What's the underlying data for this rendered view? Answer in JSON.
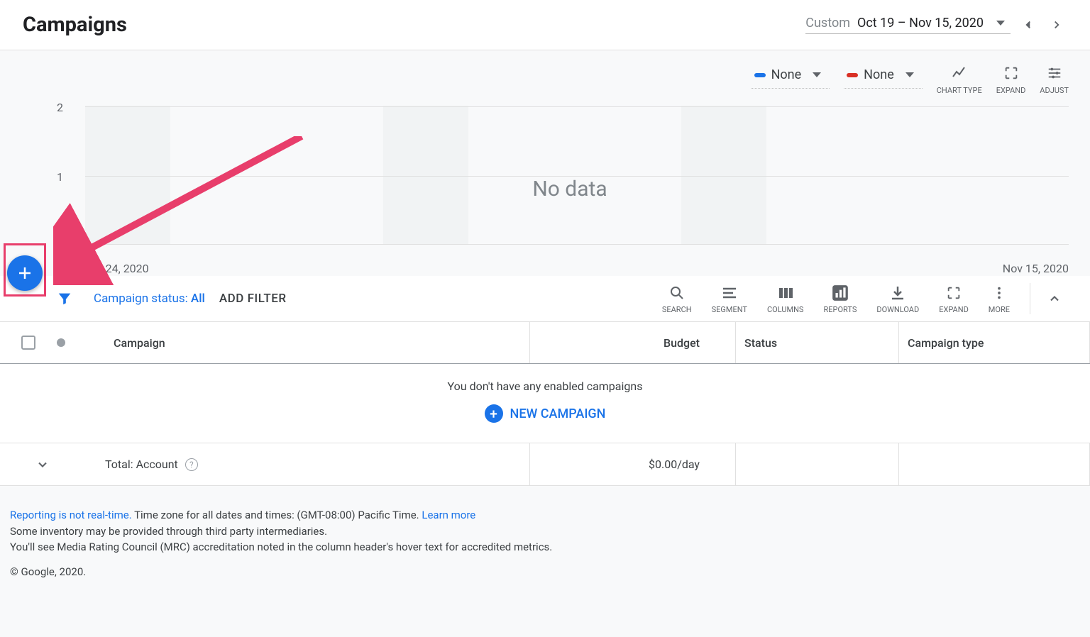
{
  "header": {
    "title": "Campaigns",
    "date_label": "Custom",
    "date_range": "Oct 19 – Nov 15, 2020"
  },
  "chart": {
    "metric1": "None",
    "metric2": "None",
    "chart_type_label": "CHART TYPE",
    "expand_label": "EXPAND",
    "adjust_label": "ADJUST",
    "nodata": "No data"
  },
  "chart_data": {
    "type": "line",
    "title": "",
    "xlabel": "",
    "ylabel": "",
    "ylim": [
      0,
      2
    ],
    "y_ticks": [
      0,
      1,
      2
    ],
    "x_start": "Oct 24, 2020",
    "x_end": "Nov 15, 2020",
    "series": [],
    "empty_message": "No data"
  },
  "filter_bar": {
    "status_label": "Campaign status: ",
    "status_value": "All",
    "add_filter": "ADD FILTER",
    "tools": {
      "search": "SEARCH",
      "segment": "SEGMENT",
      "columns": "COLUMNS",
      "reports": "REPORTS",
      "download": "DOWNLOAD",
      "expand": "EXPAND",
      "more": "MORE"
    }
  },
  "table": {
    "headers": {
      "campaign": "Campaign",
      "budget": "Budget",
      "status": "Status",
      "type": "Campaign type"
    },
    "empty_msg": "You don't have any enabled campaigns",
    "new_campaign": "NEW CAMPAIGN",
    "total_label": "Total: Account",
    "total_budget": "$0.00/day"
  },
  "footer": {
    "line1_a": "Reporting is not real-time.",
    "line1_b": " Time zone for all dates and times: (GMT-08:00) Pacific Time. ",
    "line1_c": "Learn more",
    "line2": "Some inventory may be provided through third party intermediaries.",
    "line3": "You'll see Media Rating Council (MRC) accreditation noted in the column header's hover text for accredited metrics.",
    "copyright": "© Google, 2020."
  }
}
